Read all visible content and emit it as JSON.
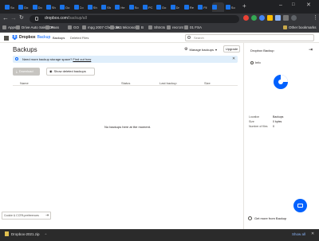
{
  "browser": {
    "tabs": [
      {
        "label": "So",
        "color": "blue"
      },
      {
        "label": "Do",
        "color": "blue"
      },
      {
        "label": "Do",
        "color": "blue"
      },
      {
        "label": "Sh",
        "color": "blue"
      },
      {
        "label": "Do",
        "color": "blue"
      },
      {
        "label": "Co",
        "color": "blue"
      },
      {
        "label": "Sh",
        "color": "blue"
      },
      {
        "label": "Sh",
        "color": "blue"
      },
      {
        "label": "He",
        "color": "blue"
      },
      {
        "label": "So",
        "color": "blue"
      },
      {
        "label": "PC",
        "color": "blue"
      },
      {
        "label": "Do",
        "color": "blue"
      },
      {
        "label": "Dr",
        "color": "blue"
      },
      {
        "label": "Re",
        "color": "blue"
      },
      {
        "label": "Fil",
        "color": "blue"
      },
      {
        "label": "",
        "color": "blue"
      },
      {
        "label": "So",
        "color": "blue"
      }
    ],
    "url_domain": "dropbox.com",
    "url_path": "/backup/all",
    "bookmarks": [
      "Apps",
      "Drive Auto Sales De...",
      "Pass",
      "GO",
      "mpg 2007 Chevrole...",
      "383 Microsoft",
      "B",
      "Shtrcts",
      "recrcnt",
      "01 FSA"
    ],
    "other_bookmarks": "Other bookmarks"
  },
  "nav": {
    "logo": "Dropbox",
    "logo_sub": "Backup",
    "links": [
      "Backups",
      "Deleted Files"
    ],
    "search_placeholder": "Search"
  },
  "main": {
    "title": "Backups",
    "manage": "Manage backups",
    "upgrade": "Upgrade",
    "banner_text": "Need more backup storage space?",
    "banner_link": "Find out how",
    "btn_download": "Download",
    "btn_deleted": "Show deleted backups",
    "columns": [
      "Name",
      "Status",
      "Last backup",
      "Size"
    ],
    "empty": "No backups here at the moment."
  },
  "panel": {
    "title": "Dropbox Backup",
    "tab": "Info",
    "props": [
      {
        "label": "Location",
        "value": "Backups"
      },
      {
        "label": "Size",
        "value": "0 bytes"
      },
      {
        "label": "Number of files",
        "value": "0"
      }
    ],
    "footer": "Get more from Backup"
  },
  "cookie": {
    "label": "Cookie & CCPA preferences"
  },
  "download_bar": {
    "file": "Dropbox-2021.zip",
    "show_all": "Show all"
  },
  "colors": {
    "accent": "#0061fe",
    "text": "#1e1919"
  }
}
